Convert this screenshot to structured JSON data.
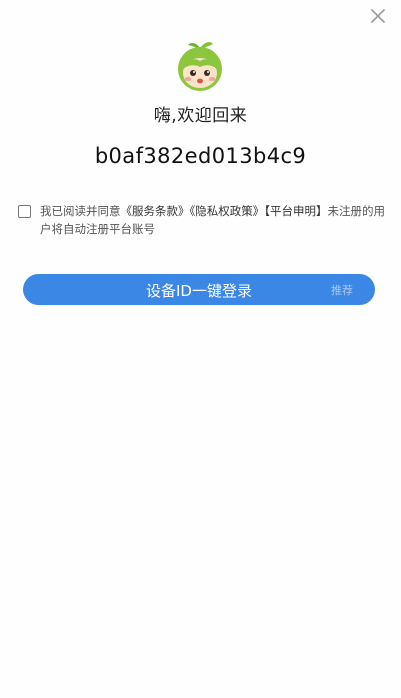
{
  "dialog": {
    "greeting": "嗨,欢迎回来",
    "device_id": "b0af382ed013b4c9"
  },
  "agreement": {
    "prefix": "我已阅读并同意",
    "service_terms": "《服务条款》",
    "privacy_policy": "《隐私权政策》",
    "platform_statement": "【平台申明】",
    "suffix": "未注册的用户将自动注册平台账号",
    "checked": false
  },
  "login_button": {
    "label": "设备ID一键登录",
    "badge": "推荐"
  },
  "icons": {
    "close": "close-icon",
    "avatar": "mascot-avatar-icon"
  },
  "colors": {
    "accent": "#3b87e6",
    "badge_text": "#a9c8f2",
    "mascot_green": "#8cc63f"
  }
}
